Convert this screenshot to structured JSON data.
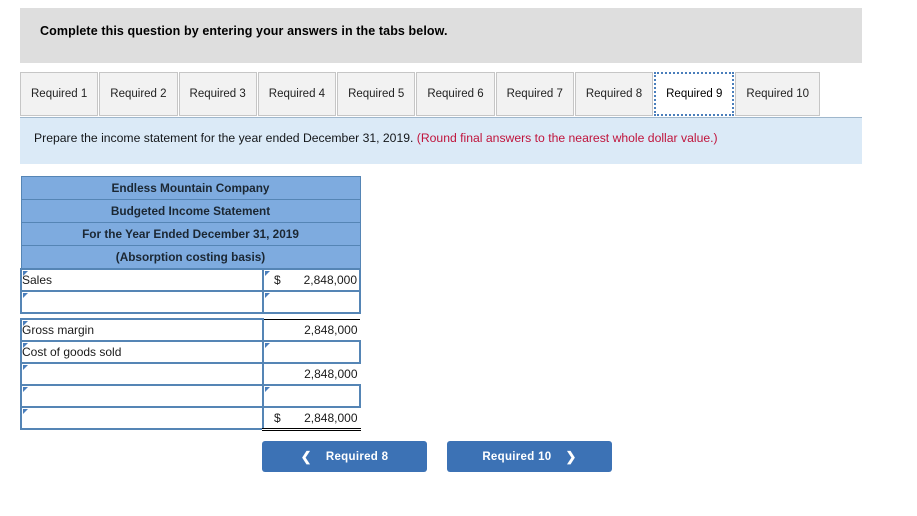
{
  "banner": {
    "text": "Complete this question by entering your answers in the tabs below."
  },
  "tabs": {
    "active_index": 8,
    "items": [
      {
        "label": "Required 1"
      },
      {
        "label": "Required 2"
      },
      {
        "label": "Required 3"
      },
      {
        "label": "Required 4"
      },
      {
        "label": "Required 5"
      },
      {
        "label": "Required 6"
      },
      {
        "label": "Required 7"
      },
      {
        "label": "Required 8"
      },
      {
        "label": "Required 9"
      },
      {
        "label": "Required 10"
      }
    ]
  },
  "instructions": {
    "main": "Prepare the income statement for the year ended December 31, 2019. ",
    "note": "(Round final answers to the nearest whole dollar value.)"
  },
  "statement": {
    "headers": [
      "Endless Mountain Company",
      "Budgeted Income Statement",
      "For the Year Ended December 31, 2019",
      "(Absorption costing basis)"
    ],
    "rows": [
      {
        "label": "Sales",
        "currency": "$",
        "value": "2,848,000",
        "value_style": "input"
      },
      {
        "label": "",
        "currency": "",
        "value": "",
        "value_style": "input"
      },
      {
        "label": "Gross margin",
        "currency": "",
        "value": "2,848,000",
        "value_style": "computed"
      },
      {
        "label": "Cost of goods sold",
        "currency": "",
        "value": "",
        "value_style": "input"
      },
      {
        "label": "",
        "currency": "",
        "value": "2,848,000",
        "value_style": "computed"
      },
      {
        "label": "",
        "currency": "",
        "value": "",
        "value_style": "input"
      },
      {
        "label": "",
        "currency": "$",
        "value": "2,848,000",
        "value_style": "total"
      }
    ],
    "spacer_after_row": 1
  },
  "nav": {
    "prev_label": "Required 8",
    "prev_icon": "chevron-left-icon",
    "next_label": "Required 10",
    "next_icon": "chevron-right-icon"
  },
  "colors": {
    "banner_bg": "#dedede",
    "instructions_bg": "#dbeaf7",
    "warn_text": "#c0143c",
    "table_header_bg": "#7eabdf",
    "cell_border": "#5585b5",
    "button_bg": "#3c72b5",
    "tab_bg": "#f2f2f2",
    "tab_active_bg": "#ffffff"
  }
}
